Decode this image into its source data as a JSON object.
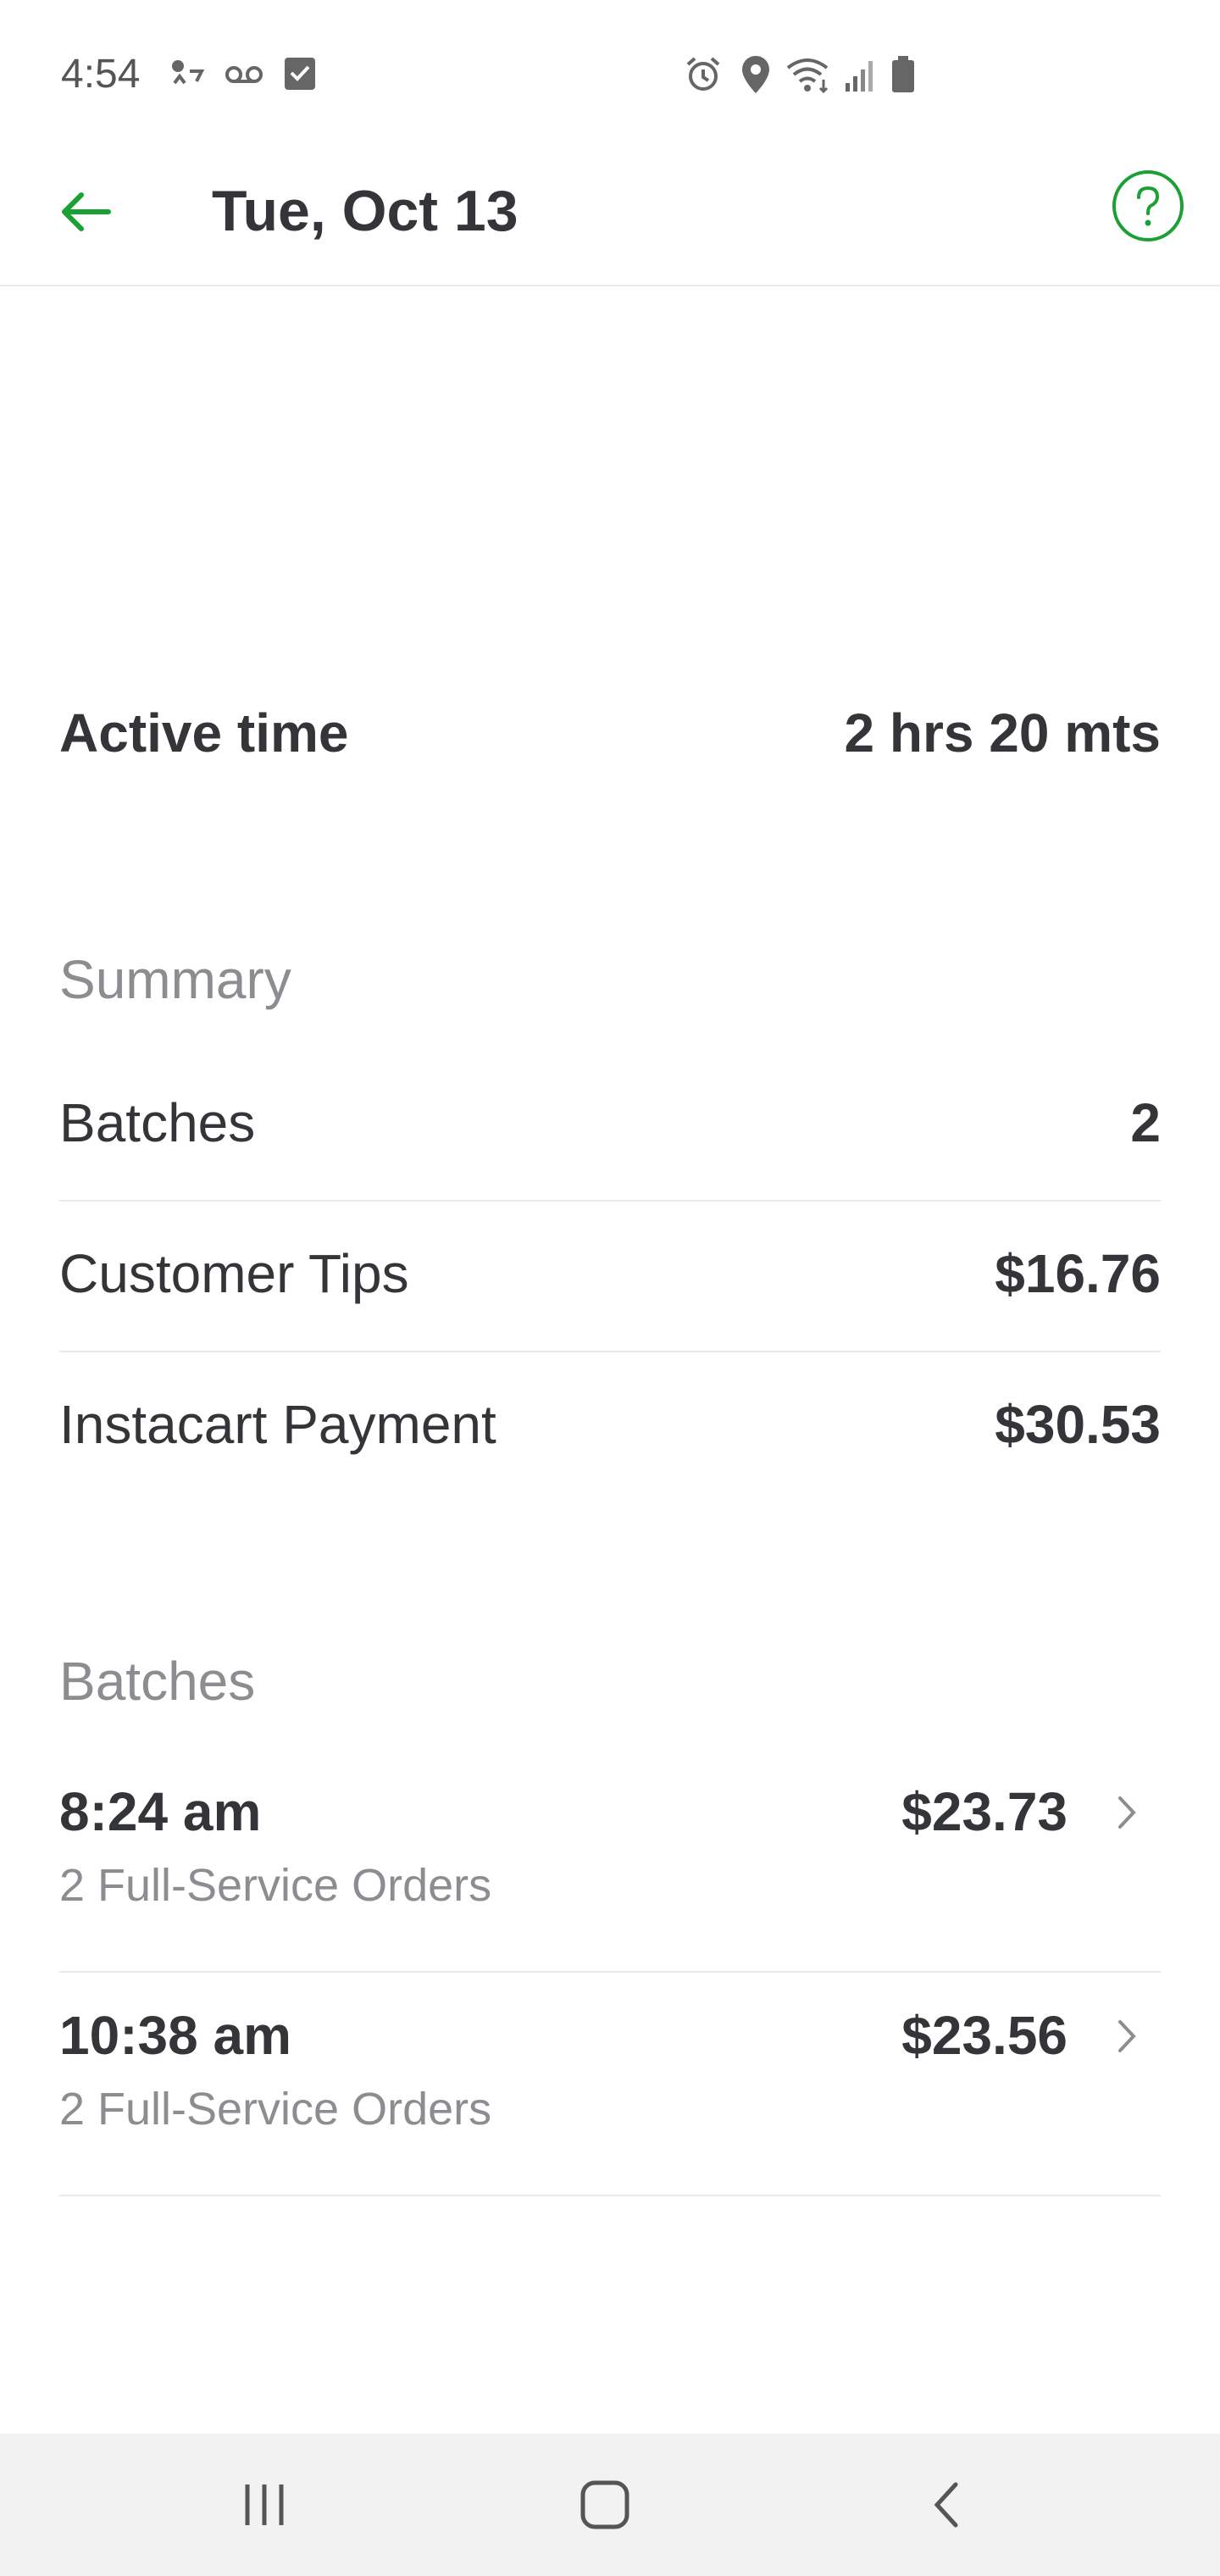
{
  "status_bar": {
    "time": "4:54"
  },
  "header": {
    "title": "Tue, Oct 13",
    "back_icon": "arrow-left-icon",
    "help_icon": "question-circle-icon",
    "accent_color": "#1aa033"
  },
  "active_time": {
    "label": "Active time",
    "value": "2 hrs 20 mts"
  },
  "summary": {
    "heading": "Summary",
    "rows": [
      {
        "label": "Batches",
        "value": "2"
      },
      {
        "label": "Customer Tips",
        "value": "$16.76"
      },
      {
        "label": "Instacart Payment",
        "value": "$30.53"
      }
    ]
  },
  "batches": {
    "heading": "Batches",
    "items": [
      {
        "time": "8:24 am",
        "description": "2 Full-Service Orders",
        "amount": "$23.73"
      },
      {
        "time": "10:38 am",
        "description": "2 Full-Service Orders",
        "amount": "$23.56"
      }
    ]
  },
  "nav_bar": {
    "icons": [
      "recent-apps-icon",
      "home-icon",
      "back-icon"
    ]
  }
}
